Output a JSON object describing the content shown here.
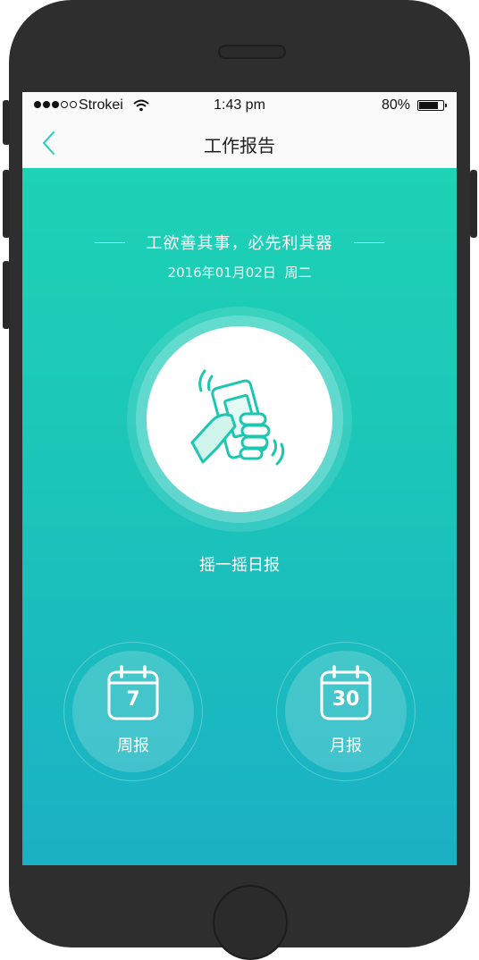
{
  "status_bar": {
    "carrier": "Strokei",
    "time": "1:43 pm",
    "battery": "80%",
    "battery_level": 0.8
  },
  "nav": {
    "title": "工作报告",
    "back_icon": "chevron-left-icon"
  },
  "hero": {
    "slogan": "工欲善其事，必先利其器",
    "date": "2016年01月02日",
    "weekday": "周二"
  },
  "shake": {
    "icon": "shake-phone-icon",
    "label": "摇一摇日报"
  },
  "reports": [
    {
      "number": "7",
      "label": "周报",
      "icon": "calendar-icon"
    },
    {
      "number": "30",
      "label": "月报",
      "icon": "calendar-icon"
    }
  ],
  "colors": {
    "accent": "#1ED2B5",
    "gradient_top": "#1ED2B5",
    "gradient_bottom": "#1AB0C5"
  }
}
